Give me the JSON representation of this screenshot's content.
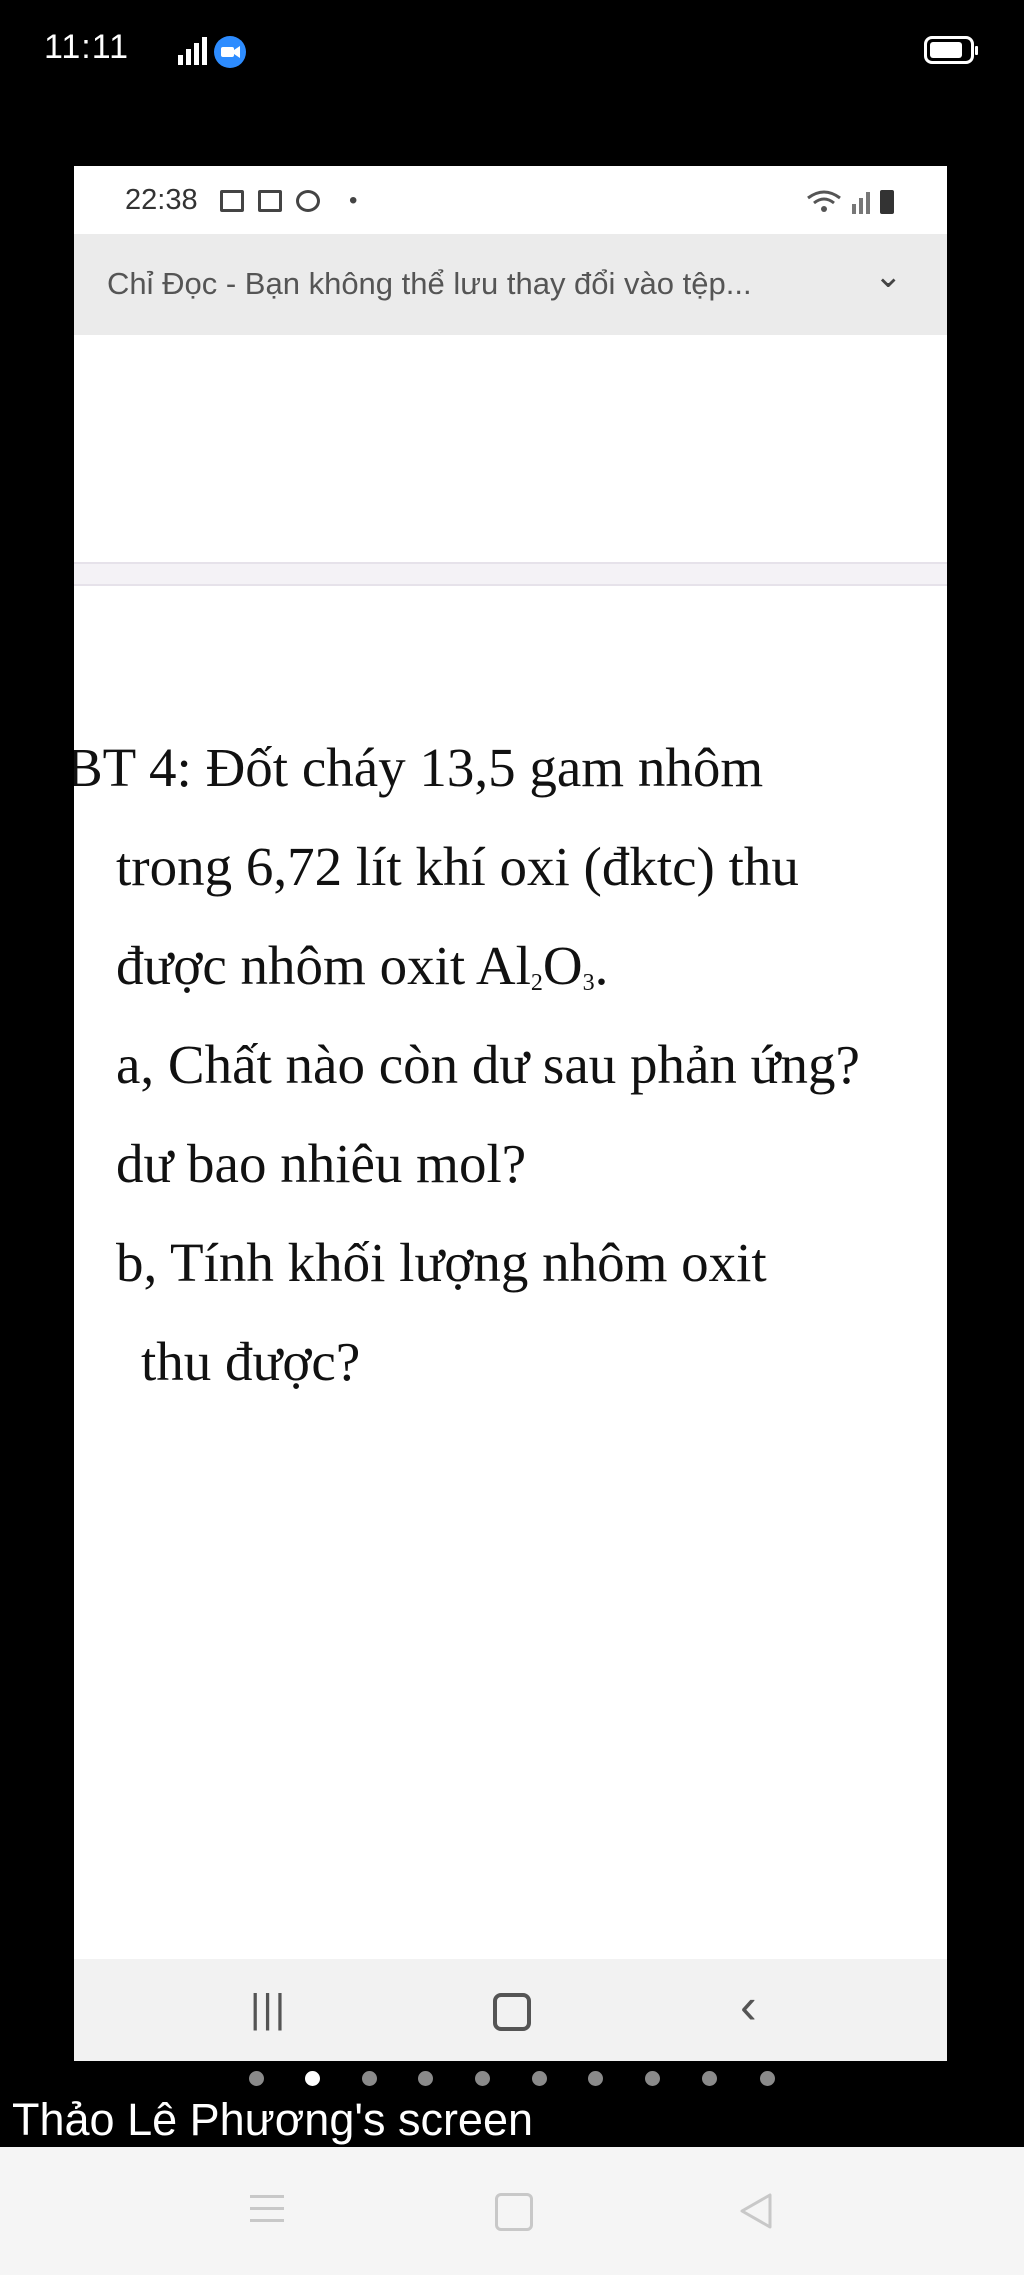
{
  "outer_status": {
    "time": "11:11",
    "network": "4G"
  },
  "shared_screen": {
    "status_time": "22:38",
    "readonly_banner": "Chỉ Đọc - Bạn không thể lưu thay đổi vào tệp...",
    "problem": {
      "title": "BT 4: Đốt cháy 13,5 gam nhôm",
      "line2": "trong 6,72 lít khí oxi (đktc) thu",
      "line3_prefix": "được nhôm oxit Al",
      "sub1": "2",
      "line3_o": "O",
      "sub2": "3",
      "line3_end": ".",
      "a_line1": "a, Chất nào còn dư sau phản ứng?",
      "a_line2": "dư bao nhiêu mol?",
      "b_line1": "b, Tính khối lượng nhôm oxit",
      "b_line2": "thu được?"
    }
  },
  "pager": {
    "count": 10,
    "active_index": 1
  },
  "screen_owner_label": "Thảo Lê Phương's screen"
}
